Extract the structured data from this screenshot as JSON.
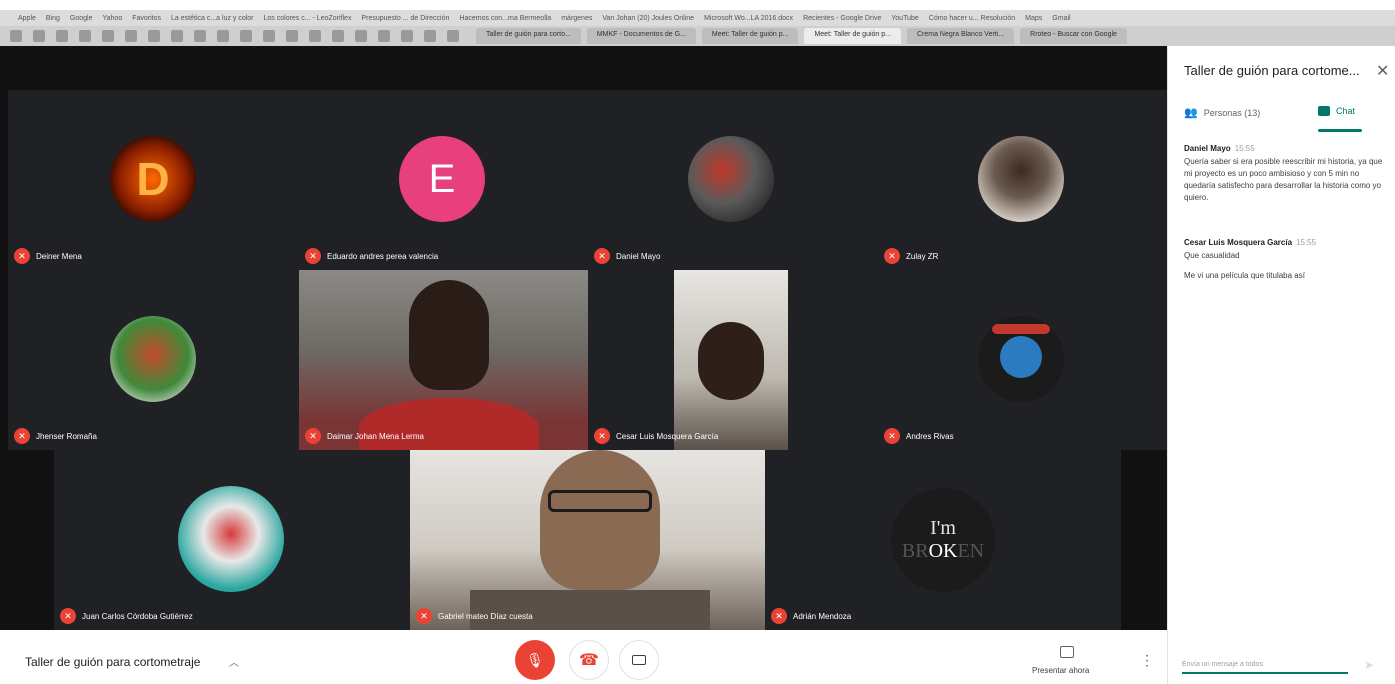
{
  "browser": {
    "bookmarks": [
      "Apple",
      "Bing",
      "Google",
      "Yahoo",
      "Favoritos",
      "La estética c...a luz y color",
      "Los colores c... - LeoZoriflex",
      "Presupuesto ... de Dirección",
      "Hacemos con...ma Bermeolla",
      "márgenes",
      "Van Johan (20) Joules Online",
      "Microsoft Wo...LA 2016.docx",
      "Recientes - Google Drive",
      "YouTube",
      "Cómo hacer u... Resolución",
      "Maps",
      "Gmail"
    ],
    "tabs": [
      {
        "label": "Taller de guión para corto...",
        "active": false
      },
      {
        "label": "MMKF - Documentos de G...",
        "active": false
      },
      {
        "label": "Meet: Taller de guión p...",
        "active": false
      },
      {
        "label": "Meet: Taller de guión p...",
        "active": true
      },
      {
        "label": "Crema Negra Blanco Verti...",
        "active": false
      },
      {
        "label": "Rroteo - Buscar con Google",
        "active": false
      }
    ]
  },
  "participants": [
    {
      "name": "Deiner Mena",
      "avatar_type": "letter-d-flame",
      "avatar_letter": "D",
      "color": "#8a1e00"
    },
    {
      "name": "Eduardo andres perea valencia",
      "avatar_type": "letter",
      "avatar_letter": "E",
      "color": "#e8407c"
    },
    {
      "name": "Daniel Mayo",
      "avatar_type": "photo",
      "avatar_letter": "",
      "color": "#6b6b6b"
    },
    {
      "name": "Zulay ZR",
      "avatar_type": "photo",
      "avatar_letter": "",
      "color": "#8a8a8a"
    },
    {
      "name": "Jhenser Romaña",
      "avatar_type": "photo",
      "avatar_letter": "",
      "color": "#c44a2a"
    },
    {
      "name": "Daimar Johan Mena Lerma",
      "avatar_type": "video",
      "avatar_letter": "",
      "color": "#7a7266"
    },
    {
      "name": "Cesar Luis Mosquera García",
      "avatar_type": "video",
      "avatar_letter": "",
      "color": "#6a5d52"
    },
    {
      "name": "Andres Rivas",
      "avatar_type": "illustration",
      "avatar_letter": "",
      "color": "#2a7bbf"
    },
    {
      "name": "Juan Carlos Córdoba Gutiérrez",
      "avatar_type": "photo",
      "avatar_letter": "",
      "color": "#2aa6a0"
    },
    {
      "name": "Gabriel mateo Díaz cuesta",
      "avatar_type": "video",
      "avatar_letter": "",
      "color": "#7a6a5e"
    },
    {
      "name": "Adrián Mendoza",
      "avatar_type": "text-logo",
      "avatar_letter": "",
      "color": "#1b1b1b"
    }
  ],
  "broken_logo": {
    "line1": "I'm",
    "pre": "BR",
    "mid": "OK",
    "post": "EN"
  },
  "panel": {
    "title": "Taller de guión para cortome...",
    "close_icon": "close-icon",
    "people_tab": "Personas (13)",
    "chat_tab": "Chat",
    "messages": [
      {
        "sender": "Daniel Mayo",
        "time": "15:55",
        "lines": [
          "Quería saber si era posible reescribir mi historia, ya que mi proyecto es un poco ambisioso y con 5 min no quedaría satisfecho para desarrollar la historia como yo quiero."
        ]
      },
      {
        "sender": "Cesar Luis Mosquera García",
        "time": "15:55",
        "lines": [
          "Que casualidad",
          "Me vi una película que titulaba así"
        ]
      }
    ],
    "input_placeholder": "Envía un mensaje a todos",
    "accent": "#00796b"
  },
  "bottom": {
    "meeting_title": "Taller de guión para cortometraje",
    "present_label": "Presentar ahora",
    "mic_state": "muted",
    "accent_red": "#ea4335"
  }
}
